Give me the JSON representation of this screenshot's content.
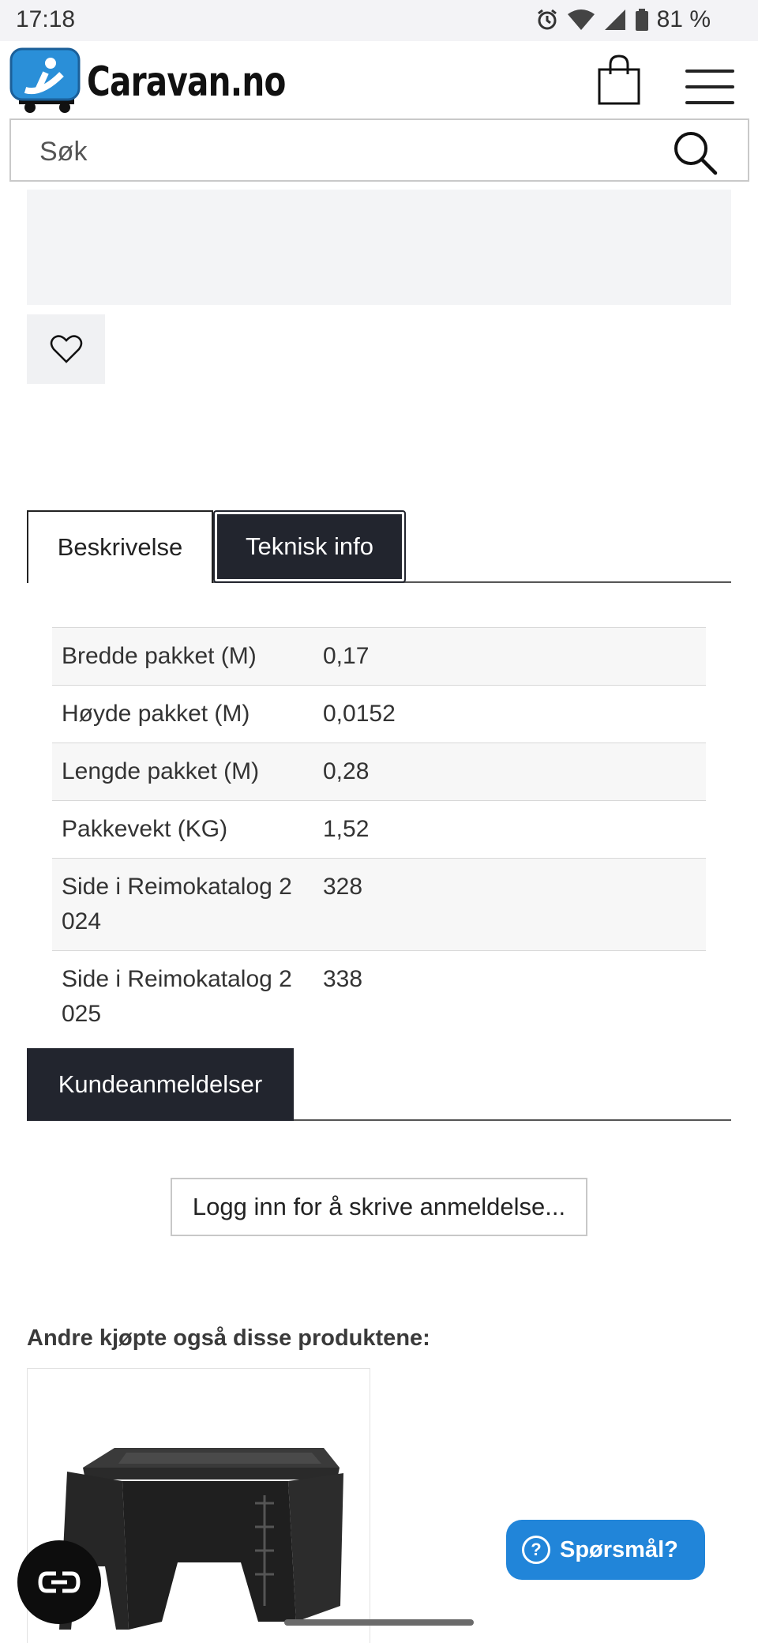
{
  "status_bar": {
    "time": "17:18",
    "battery": "81 %"
  },
  "header": {
    "logo_text": "Caravan.no"
  },
  "search": {
    "placeholder": "Søk"
  },
  "tabs": [
    {
      "label": "Beskrivelse",
      "active": false
    },
    {
      "label": "Teknisk info",
      "active": true
    }
  ],
  "specs": [
    {
      "key": "Bredde pakket (M)",
      "value": "0,17"
    },
    {
      "key": "Høyde pakket (M)",
      "value": "0,0152"
    },
    {
      "key": "Lengde pakket (M)",
      "value": "0,28"
    },
    {
      "key": "Pakkevekt (KG)",
      "value": "1,52"
    },
    {
      "key": "Side i Reimokatalog 2024",
      "value": "328"
    },
    {
      "key": "Side i Reimokatalog 2025",
      "value": "338"
    }
  ],
  "reviews": {
    "tab_label": "Kundeanmeldelser",
    "login_button": "Logg inn for å skrive anmeldelse..."
  },
  "related": {
    "title": "Andre kjøpte også disse produktene:"
  },
  "help_button": {
    "label": "Spørsmål?"
  },
  "colors": {
    "dark": "#22252e",
    "accent": "#2185d9",
    "logo_blue": "#2a8fd8"
  },
  "icons": [
    "alarm-icon",
    "wifi-icon",
    "signal-icon",
    "battery-icon",
    "cart-icon",
    "menu-icon",
    "search-icon",
    "heart-icon",
    "question-icon",
    "chat-icon"
  ]
}
